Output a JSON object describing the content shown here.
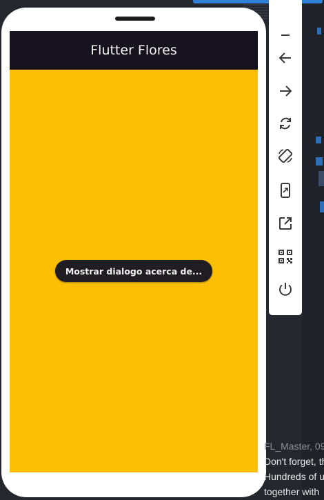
{
  "app": {
    "title": "Flutter Flores",
    "button_label": "Mostrar dialogo acerca de...",
    "background_color": "#fcbf03",
    "appbar_color": "#16131f"
  },
  "toolbar": {
    "items": [
      {
        "name": "minimize-icon"
      },
      {
        "name": "back-arrow-icon"
      },
      {
        "name": "forward-arrow-icon"
      },
      {
        "name": "rotate-icon"
      },
      {
        "name": "rotate-device-icon"
      },
      {
        "name": "resize-device-icon"
      },
      {
        "name": "open-external-icon"
      },
      {
        "name": "qr-code-icon"
      },
      {
        "name": "power-icon"
      }
    ]
  },
  "notification": {
    "title": "FL_Master, 09",
    "lines": [
      "Don't forget, th",
      "Hundreds of u",
      "together with"
    ]
  }
}
